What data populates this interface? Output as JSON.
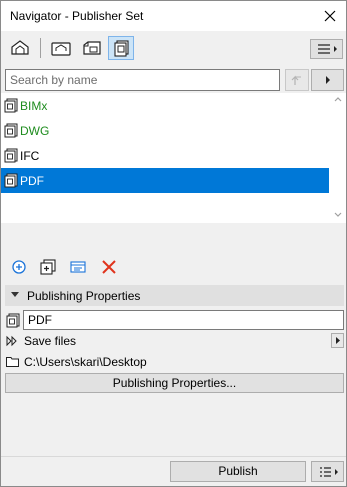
{
  "window": {
    "title": "Navigator - Publisher Set"
  },
  "toolbar": {
    "icons": [
      "project-map-icon",
      "view-map-icon",
      "layout-book-icon",
      "publisher-sets-icon"
    ],
    "active": "publisher-sets-icon"
  },
  "search": {
    "placeholder": "Search by name",
    "value": ""
  },
  "list": {
    "items": [
      {
        "label": "BIMx",
        "color": "#1e8c1e",
        "selected": false
      },
      {
        "label": "DWG",
        "color": "#1e8c1e",
        "selected": false
      },
      {
        "label": "IFC",
        "color": "#000000",
        "selected": false
      },
      {
        "label": "PDF",
        "color": "#ffffff",
        "selected": true
      }
    ]
  },
  "actions": {
    "icons": [
      "new-item-icon",
      "new-folder-icon",
      "properties-icon",
      "delete-icon"
    ]
  },
  "properties": {
    "section_title": "Publishing Properties",
    "name_value": "PDF",
    "save_mode": "Save files",
    "path": "C:\\Users\\skari\\Desktop",
    "button_label": "Publishing Properties..."
  },
  "footer": {
    "publish_label": "Publish"
  },
  "colors": {
    "selection": "#0078d7",
    "active_tool": "#cce4f7",
    "delete": "#e0331c",
    "add": "#1a73d9"
  }
}
